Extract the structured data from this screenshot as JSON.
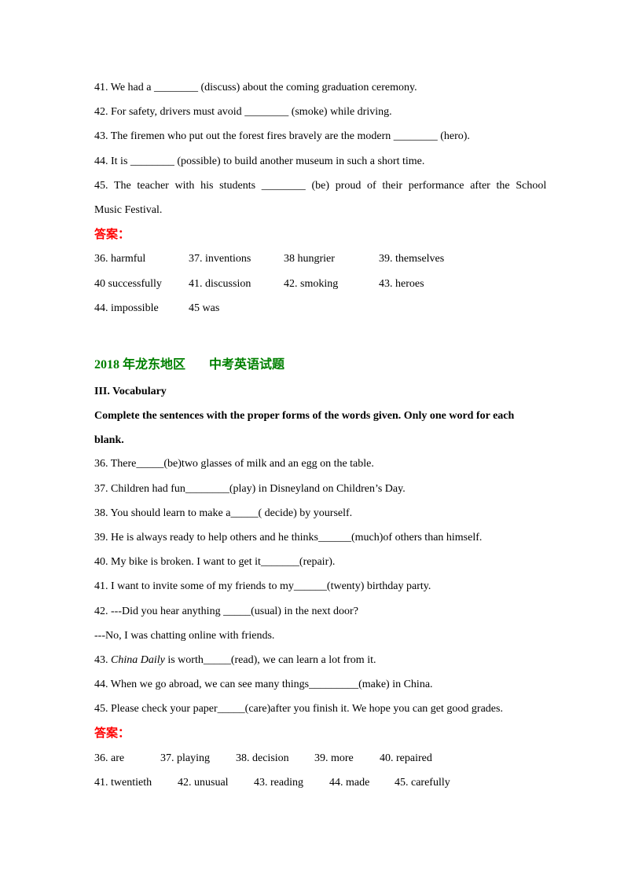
{
  "section1": {
    "questions": [
      {
        "pre": "41. We had a ",
        "blank": "________",
        "post": " (discuss) about the coming graduation ceremony."
      },
      {
        "pre": "42. For safety, drivers must avoid ",
        "blank": "________",
        "post": " (smoke) while driving."
      },
      {
        "pre": "43. The firemen who put out the forest fires bravely are the modern ",
        "blank": "________",
        "post": " (hero)."
      },
      {
        "pre": "44. It is ",
        "blank": "________",
        "post": " (possible) to build another museum in such a short time."
      },
      {
        "pre": "45. The teacher with his students ",
        "blank": "________",
        "post": " (be) proud of their performance after the School",
        "cont": "Music Festival."
      }
    ],
    "answer_label": "答案：",
    "answers": [
      [
        "36. harmful",
        "37. inventions",
        "38 hungrier",
        "39. themselves"
      ],
      [
        "40 successfully",
        "41. discussion",
        "42. smoking",
        "43. heroes"
      ],
      [
        "44. impossible",
        "45 was"
      ]
    ]
  },
  "section2": {
    "heading_year": "2018 年龙东地区",
    "heading_title": "中考英语试题",
    "part_title": "III. Vocabulary",
    "instructions_1": "Complete the sentences with the proper forms of the words given. Only one word for each",
    "instructions_2": "blank.",
    "questions": [
      {
        "pre": "36. There",
        "blank": "_____",
        "post": "(be)two glasses of milk and an egg on the table."
      },
      {
        "pre": "37. Children had fun",
        "blank": "________",
        "post": "(play) in Disneyland on Children’s Day."
      },
      {
        "pre": "38. You should learn to make a",
        "blank": "_____",
        "post": "( decide) by yourself."
      },
      {
        "pre": "39. He is always ready to help others and he thinks",
        "blank": "______",
        "post": "(much)of others than himself."
      },
      {
        "pre": "40. My bike is broken. I want to get it",
        "blank": "_______",
        "post": "(repair)."
      },
      {
        "pre": "41. I want to invite some of my friends to my",
        "blank": "______",
        "post": "(twenty) birthday party."
      },
      {
        "pre": "42. ---Did you hear anything ",
        "blank": "_____",
        "post": "(usual) in the next door?"
      },
      {
        "pre": "---No, I was chatting online with friends."
      },
      {
        "italic": "China Daily",
        "pre": " is worth",
        "blank": "_____",
        "post": "(read), we can learn a lot from it.",
        "num": "43. "
      },
      {
        "pre": "44. When we go abroad, we can see many things",
        "blank": "_________",
        "post": "(make) in China."
      },
      {
        "pre": "45. Please check your paper",
        "blank": "_____",
        "post": "(care)after you finish it. We hope you can get good grades."
      }
    ],
    "answer_label": "答案：",
    "answers": [
      [
        "36. are",
        "37. playing",
        "38. decision",
        "39. more",
        "40. repaired"
      ],
      [
        "41. twentieth",
        "42. unusual",
        "43. reading",
        "44. made",
        "45. carefully"
      ]
    ]
  }
}
